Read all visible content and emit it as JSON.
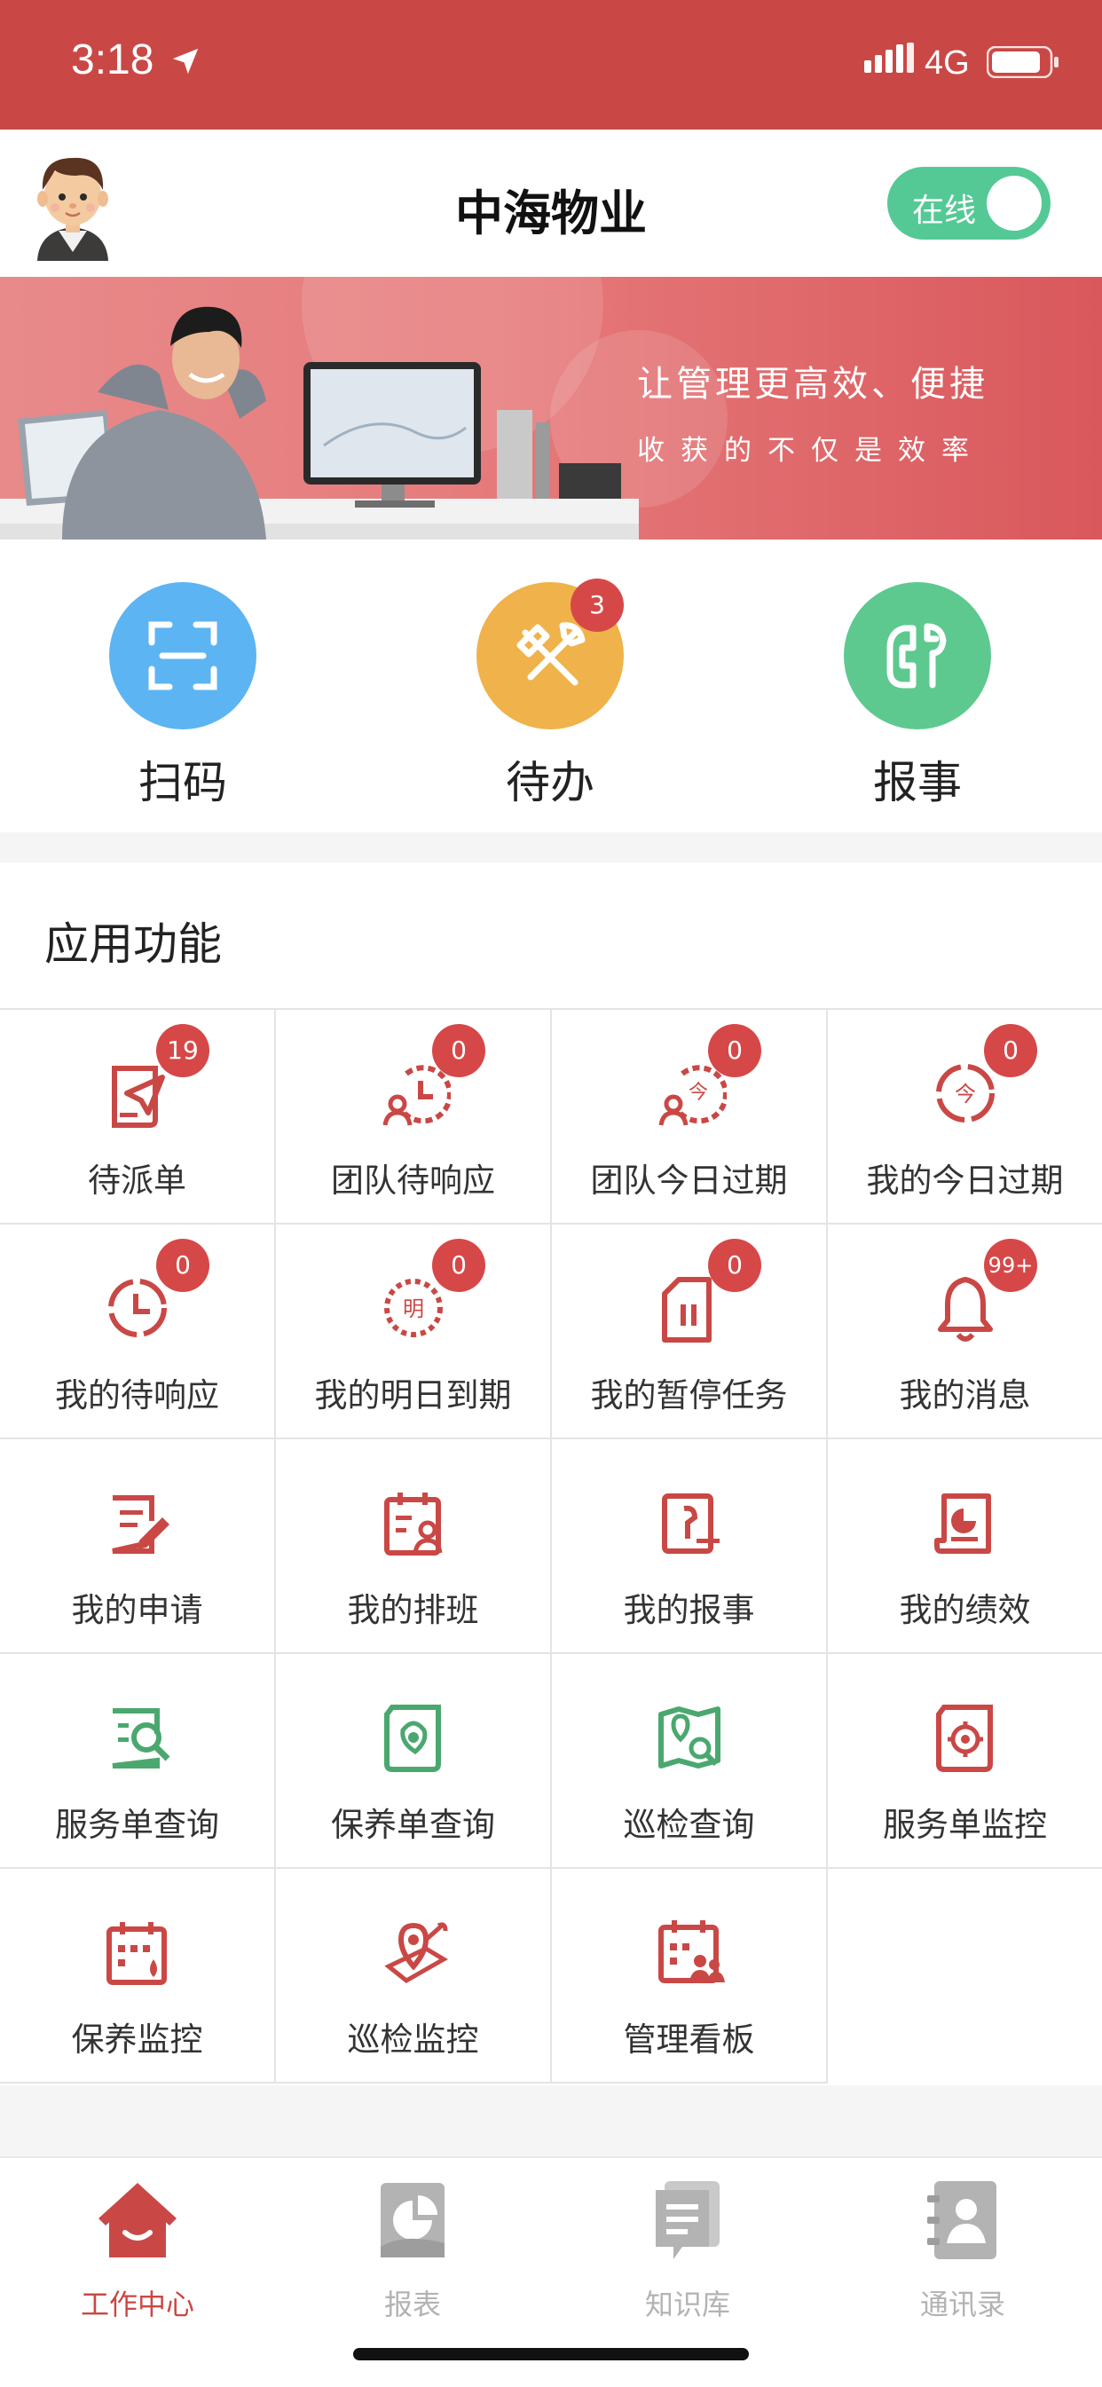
{
  "status_bar": {
    "time": "3:18",
    "network": "4G"
  },
  "header": {
    "title": "中海物业",
    "status_toggle_label": "在线"
  },
  "banner": {
    "headline": "让管理更高效、便捷",
    "subline": "收获的不仅是效率"
  },
  "quick_actions": [
    {
      "label": "扫码",
      "icon": "scan-icon",
      "color": "#5db4f2",
      "badge": ""
    },
    {
      "label": "待办",
      "icon": "tools-icon",
      "color": "#f0b24a",
      "badge": "3"
    },
    {
      "label": "报事",
      "icon": "wrench-icon",
      "color": "#5dc98f",
      "badge": ""
    }
  ],
  "apps": {
    "title": "应用功能",
    "items": [
      {
        "label": "待派单",
        "badge": "19",
        "icon": "dispatch-order-icon",
        "color": "#c94845"
      },
      {
        "label": "团队待响应",
        "badge": "0",
        "icon": "team-response-icon",
        "color": "#c94845"
      },
      {
        "label": "团队今日过期",
        "badge": "0",
        "icon": "team-today-expire-icon",
        "color": "#c94845"
      },
      {
        "label": "我的今日过期",
        "badge": "0",
        "icon": "my-today-expire-icon",
        "color": "#c94845"
      },
      {
        "label": "我的待响应",
        "badge": "0",
        "icon": "my-response-clock-icon",
        "color": "#c94845"
      },
      {
        "label": "我的明日到期",
        "badge": "0",
        "icon": "tomorrow-due-icon",
        "color": "#c94845"
      },
      {
        "label": "我的暂停任务",
        "badge": "0",
        "icon": "pause-task-icon",
        "color": "#c94845"
      },
      {
        "label": "我的消息",
        "badge": "99+",
        "icon": "bell-icon",
        "color": "#c94845"
      },
      {
        "label": "我的申请",
        "badge": "",
        "icon": "application-edit-icon",
        "color": "#c94845"
      },
      {
        "label": "我的排班",
        "badge": "",
        "icon": "schedule-calendar-icon",
        "color": "#c94845"
      },
      {
        "label": "我的报事",
        "badge": "",
        "icon": "report-wrench-icon",
        "color": "#c94845"
      },
      {
        "label": "我的绩效",
        "badge": "",
        "icon": "performance-chart-icon",
        "color": "#c94845"
      },
      {
        "label": "服务单查询",
        "badge": "",
        "icon": "service-search-icon",
        "color": "#4aa86f"
      },
      {
        "label": "保养单查询",
        "badge": "",
        "icon": "maintenance-search-icon",
        "color": "#4aa86f"
      },
      {
        "label": "巡检查询",
        "badge": "",
        "icon": "patrol-map-search-icon",
        "color": "#4aa86f"
      },
      {
        "label": "服务单监控",
        "badge": "",
        "icon": "service-monitor-icon",
        "color": "#c94845"
      },
      {
        "label": "保养监控",
        "badge": "",
        "icon": "maintenance-monitor-icon",
        "color": "#c94845"
      },
      {
        "label": "巡检监控",
        "badge": "",
        "icon": "patrol-monitor-icon",
        "color": "#c94845"
      },
      {
        "label": "管理看板",
        "badge": "",
        "icon": "dashboard-team-icon",
        "color": "#c94845"
      }
    ]
  },
  "tabbar": [
    {
      "label": "工作中心",
      "icon": "home-icon",
      "active": true
    },
    {
      "label": "报表",
      "icon": "report-chart-icon",
      "active": false
    },
    {
      "label": "知识库",
      "icon": "knowledge-doc-icon",
      "active": false
    },
    {
      "label": "通讯录",
      "icon": "contacts-icon",
      "active": false
    }
  ],
  "colors": {
    "brand": "#c94845",
    "tab_active": "#c94845",
    "tab_inactive": "#b3b3b3",
    "badge": "#d64848",
    "online": "#55c995"
  }
}
